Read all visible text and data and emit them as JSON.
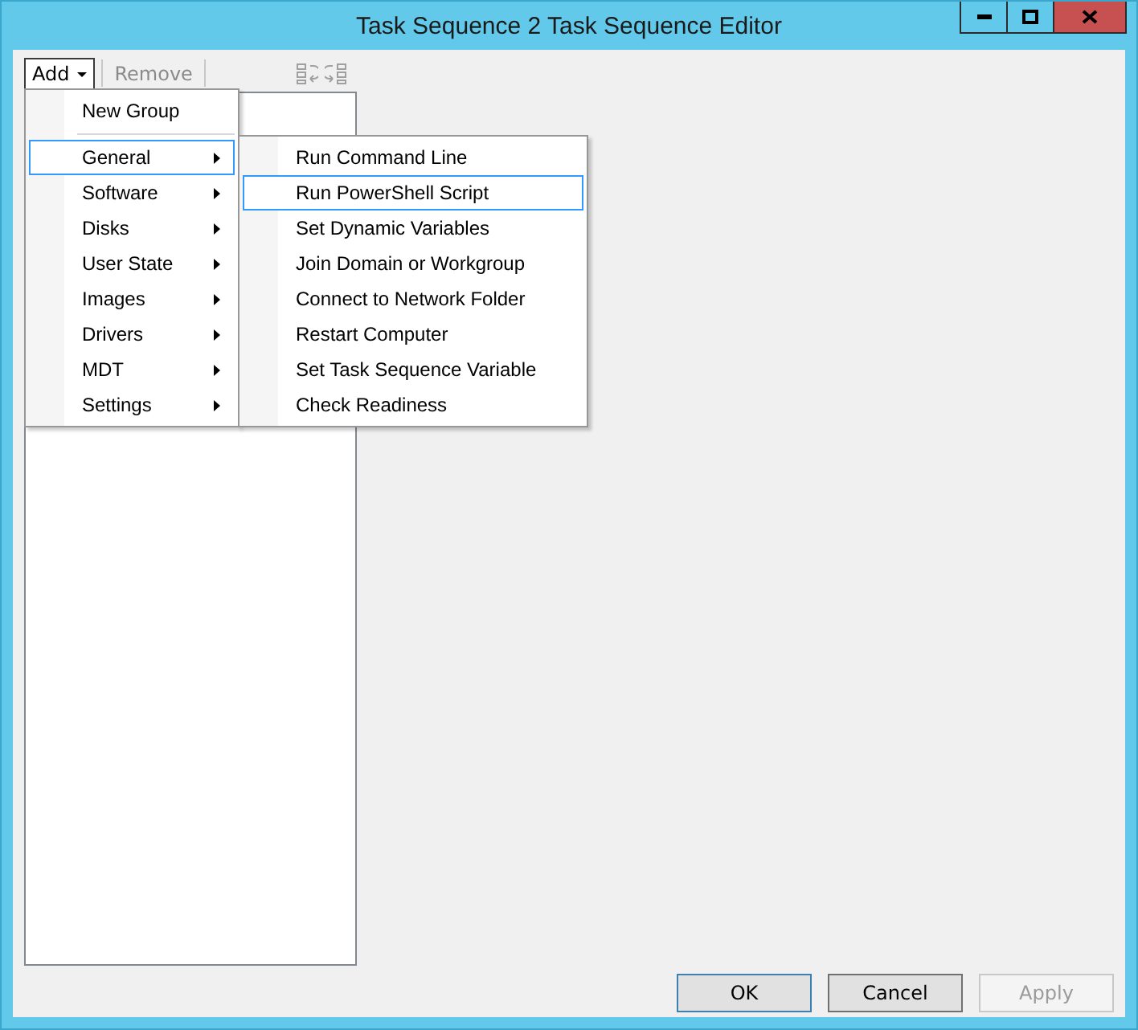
{
  "window": {
    "title": "Task Sequence 2 Task Sequence Editor"
  },
  "toolbar": {
    "add": {
      "label": "Add",
      "open": true
    },
    "remove": {
      "label": "Remove",
      "disabled": true
    }
  },
  "add_menu": [
    {
      "kind": "item",
      "label": "New Group",
      "has_submenu": false,
      "selected": false
    },
    {
      "kind": "separator"
    },
    {
      "kind": "item",
      "label": "General",
      "has_submenu": true,
      "selected": true
    },
    {
      "kind": "item",
      "label": "Software",
      "has_submenu": true,
      "selected": false
    },
    {
      "kind": "item",
      "label": "Disks",
      "has_submenu": true,
      "selected": false
    },
    {
      "kind": "item",
      "label": "User State",
      "has_submenu": true,
      "selected": false
    },
    {
      "kind": "item",
      "label": "Images",
      "has_submenu": true,
      "selected": false
    },
    {
      "kind": "item",
      "label": "Drivers",
      "has_submenu": true,
      "selected": false
    },
    {
      "kind": "item",
      "label": "MDT",
      "has_submenu": true,
      "selected": false
    },
    {
      "kind": "item",
      "label": "Settings",
      "has_submenu": true,
      "selected": false
    }
  ],
  "general_submenu": [
    {
      "label": "Run Command Line",
      "selected": false
    },
    {
      "label": "Run PowerShell Script",
      "selected": true
    },
    {
      "label": "Set Dynamic Variables",
      "selected": false
    },
    {
      "label": "Join Domain or Workgroup",
      "selected": false
    },
    {
      "label": "Connect to Network Folder",
      "selected": false
    },
    {
      "label": "Restart Computer",
      "selected": false
    },
    {
      "label": "Set Task Sequence Variable",
      "selected": false
    },
    {
      "label": "Check Readiness",
      "selected": false
    }
  ],
  "buttons": [
    {
      "label": "OK",
      "kind": "default",
      "disabled": false
    },
    {
      "label": "Cancel",
      "kind": "normal",
      "disabled": false
    },
    {
      "label": "Apply",
      "kind": "normal",
      "disabled": true
    }
  ]
}
